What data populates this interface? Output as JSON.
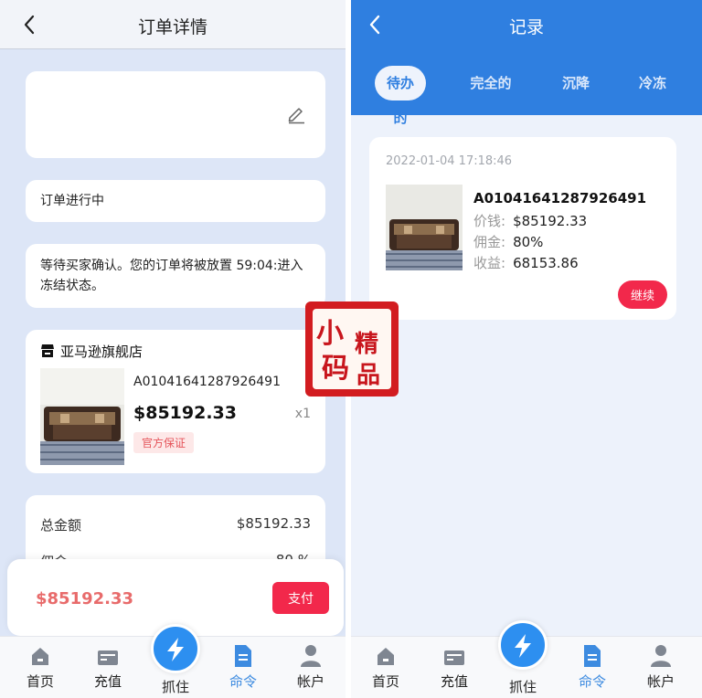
{
  "left": {
    "title": "订单详情",
    "status_text": "订单进行中",
    "notice_text": "等待买家确认。您的订单将被放置 59:04:进入冻结状态。",
    "shop": {
      "name": "亚马逊旗舰店",
      "product_id": "A01041641287926491",
      "price": "$85192.33",
      "quantity": "x1",
      "guarantee_badge": "官方保证"
    },
    "summary": {
      "total_label": "总金额",
      "total_value": "$85192.33",
      "commission_label": "佣金",
      "commission_value": "80 %"
    },
    "pay_bar": {
      "total": "$85192.33",
      "pay_button": "支付"
    }
  },
  "right": {
    "title": "记录",
    "tabs": [
      "待办的",
      "完全的",
      "沉降",
      "冷冻"
    ],
    "active_tab": 0,
    "record": {
      "time": "2022-01-04 17:18:46",
      "product_id": "A01041641287926491",
      "price_label": "价钱:",
      "price_value": "$85192.33",
      "commission_label": "佣金:",
      "commission_value": "80%",
      "income_label": "收益:",
      "income_value": "68153.86",
      "continue_button": "继续"
    }
  },
  "nav": {
    "items": [
      "首页",
      "充值",
      "抓住",
      "命令",
      "帐户"
    ],
    "active_index": 3
  },
  "watermark": [
    "小",
    "码",
    "精",
    "品"
  ],
  "colors": {
    "primary_blue": "#2f7fe0",
    "accent_red": "#f2284b",
    "price_red": "#e86b6b",
    "page_bg": "#dde6f7"
  }
}
